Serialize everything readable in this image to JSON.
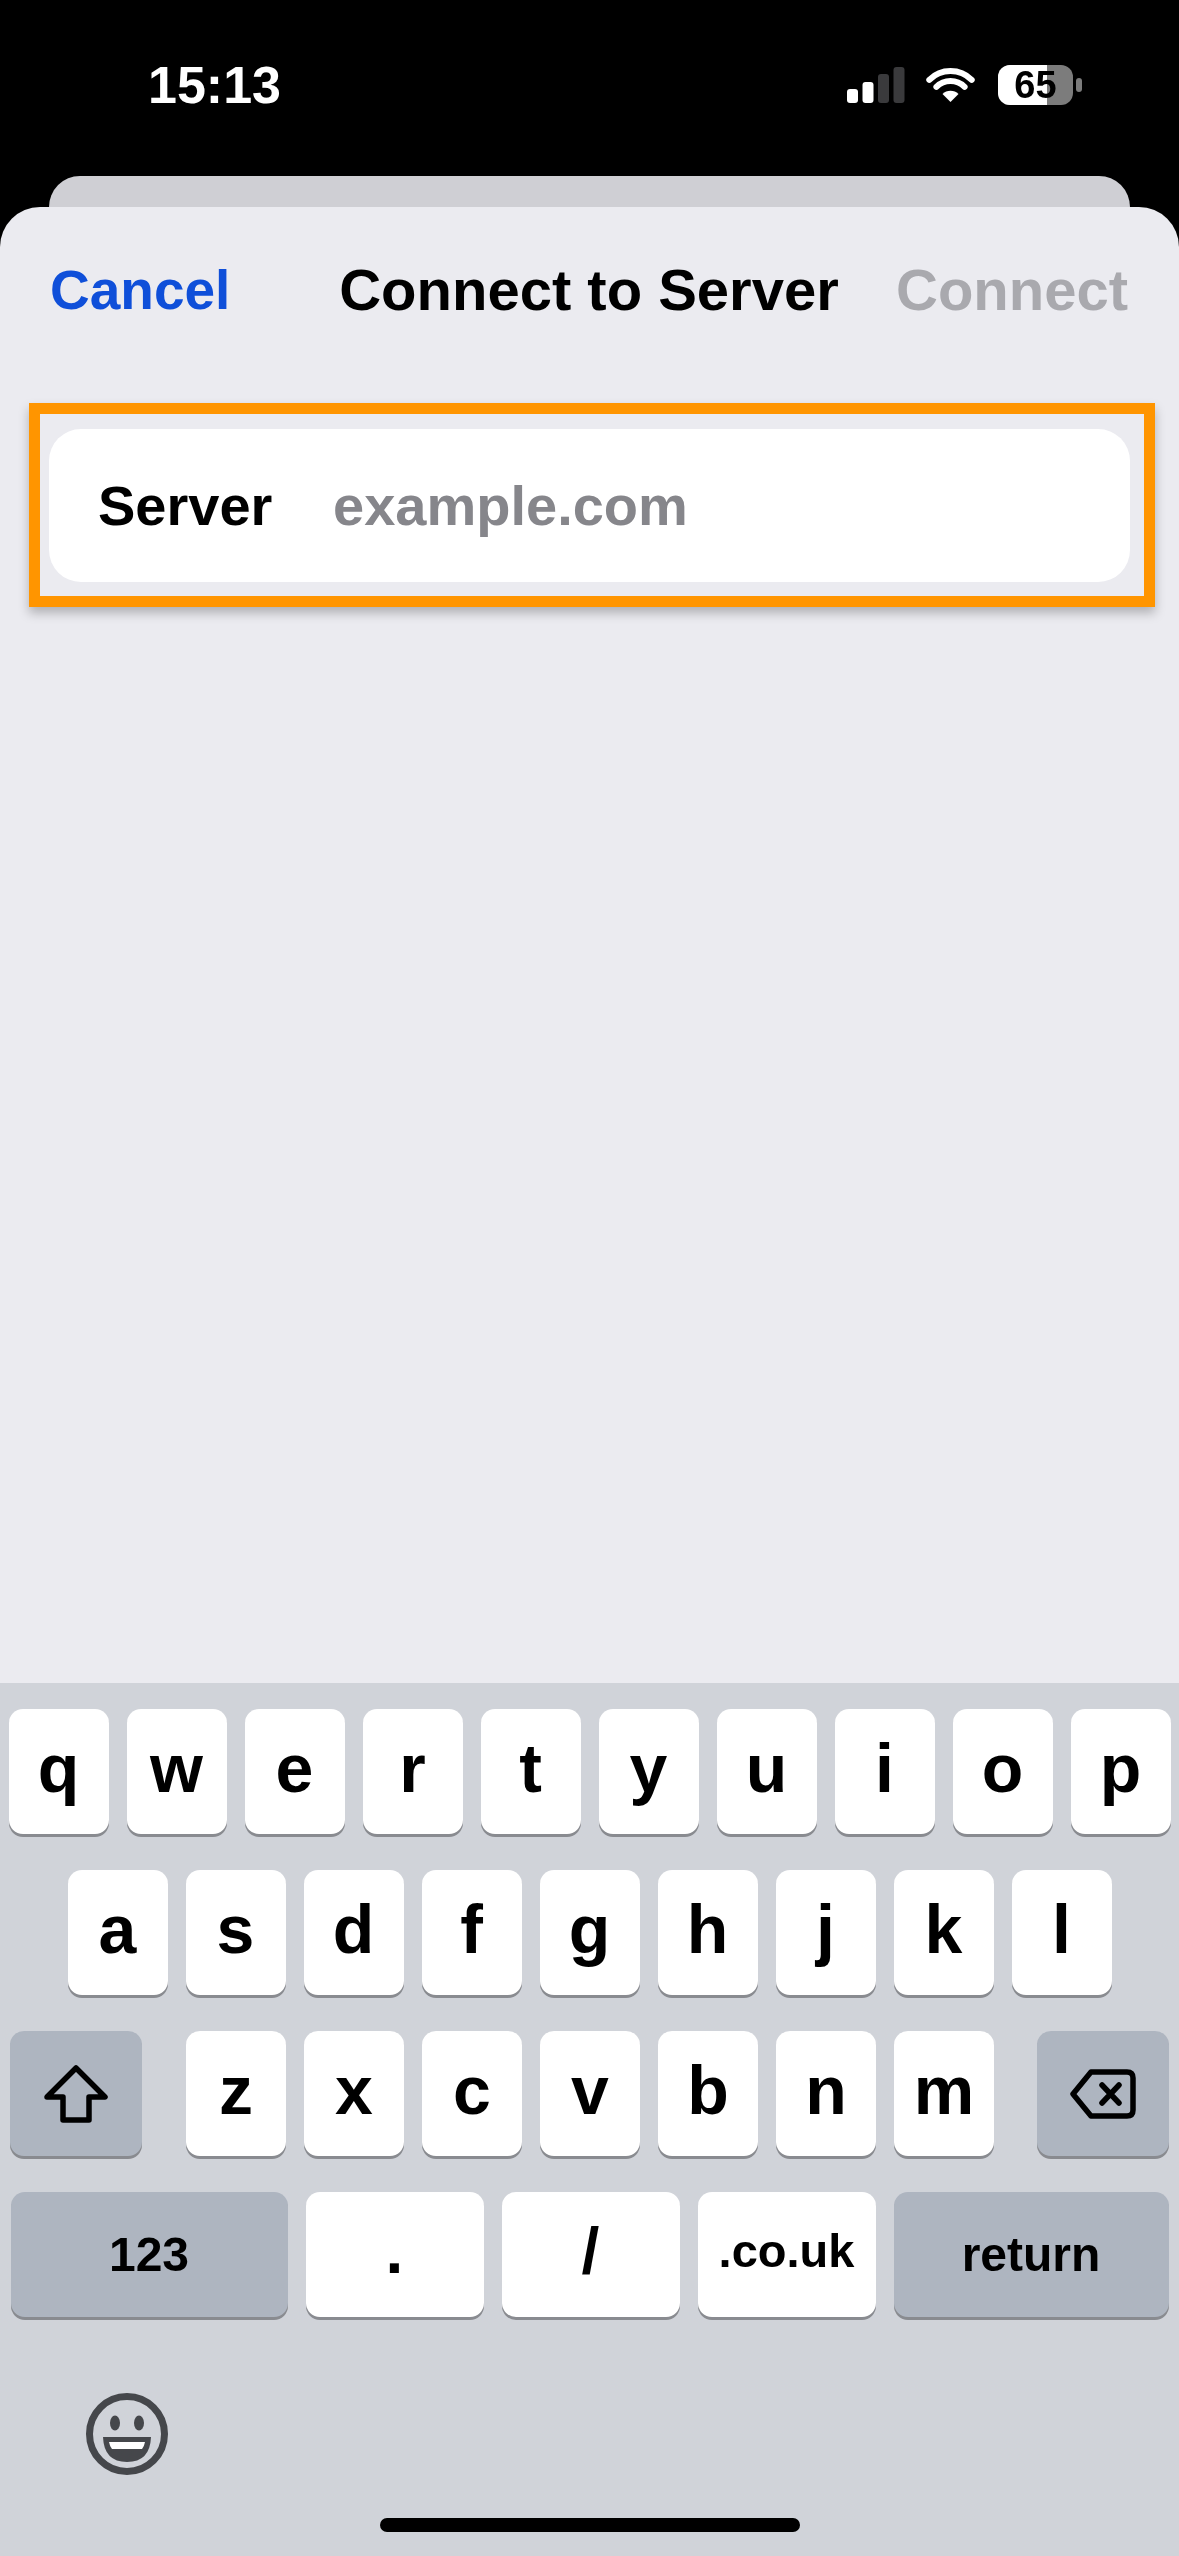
{
  "status_bar": {
    "time": "15:13",
    "battery": "65"
  },
  "sheet": {
    "cancel": "Cancel",
    "title": "Connect to Server",
    "connect": {
      "label": "Connect",
      "disabled": true
    }
  },
  "form": {
    "server": {
      "label": "Server",
      "placeholder": "example.com",
      "highlighted": true
    }
  },
  "keyboard": {
    "rows": [
      {
        "keys": [
          {
            "kind": "letter",
            "label": "q"
          },
          {
            "kind": "letter",
            "label": "w"
          },
          {
            "kind": "letter",
            "label": "e"
          },
          {
            "kind": "letter",
            "label": "r"
          },
          {
            "kind": "letter",
            "label": "t"
          },
          {
            "kind": "letter",
            "label": "y"
          },
          {
            "kind": "letter",
            "label": "u"
          },
          {
            "kind": "letter",
            "label": "i"
          },
          {
            "kind": "letter",
            "label": "o"
          },
          {
            "kind": "letter",
            "label": "p"
          }
        ]
      },
      {
        "keys": [
          {
            "kind": "letter",
            "label": "a"
          },
          {
            "kind": "letter",
            "label": "s"
          },
          {
            "kind": "letter",
            "label": "d"
          },
          {
            "kind": "letter",
            "label": "f"
          },
          {
            "kind": "letter",
            "label": "g"
          },
          {
            "kind": "letter",
            "label": "h"
          },
          {
            "kind": "letter",
            "label": "j"
          },
          {
            "kind": "letter",
            "label": "k"
          },
          {
            "kind": "letter",
            "label": "l"
          }
        ]
      },
      {
        "keys": [
          {
            "kind": "shift"
          },
          {
            "kind": "letter",
            "label": "z"
          },
          {
            "kind": "letter",
            "label": "x"
          },
          {
            "kind": "letter",
            "label": "c"
          },
          {
            "kind": "letter",
            "label": "v"
          },
          {
            "kind": "letter",
            "label": "b"
          },
          {
            "kind": "letter",
            "label": "n"
          },
          {
            "kind": "letter",
            "label": "m"
          },
          {
            "kind": "delete"
          }
        ]
      },
      {
        "keys": [
          {
            "kind": "mode",
            "label": "123"
          },
          {
            "kind": "symbol",
            "label": "."
          },
          {
            "kind": "symbol",
            "label": "/"
          },
          {
            "kind": "domain",
            "label": ".co.uk"
          },
          {
            "kind": "return",
            "label": "return"
          }
        ]
      }
    ]
  }
}
